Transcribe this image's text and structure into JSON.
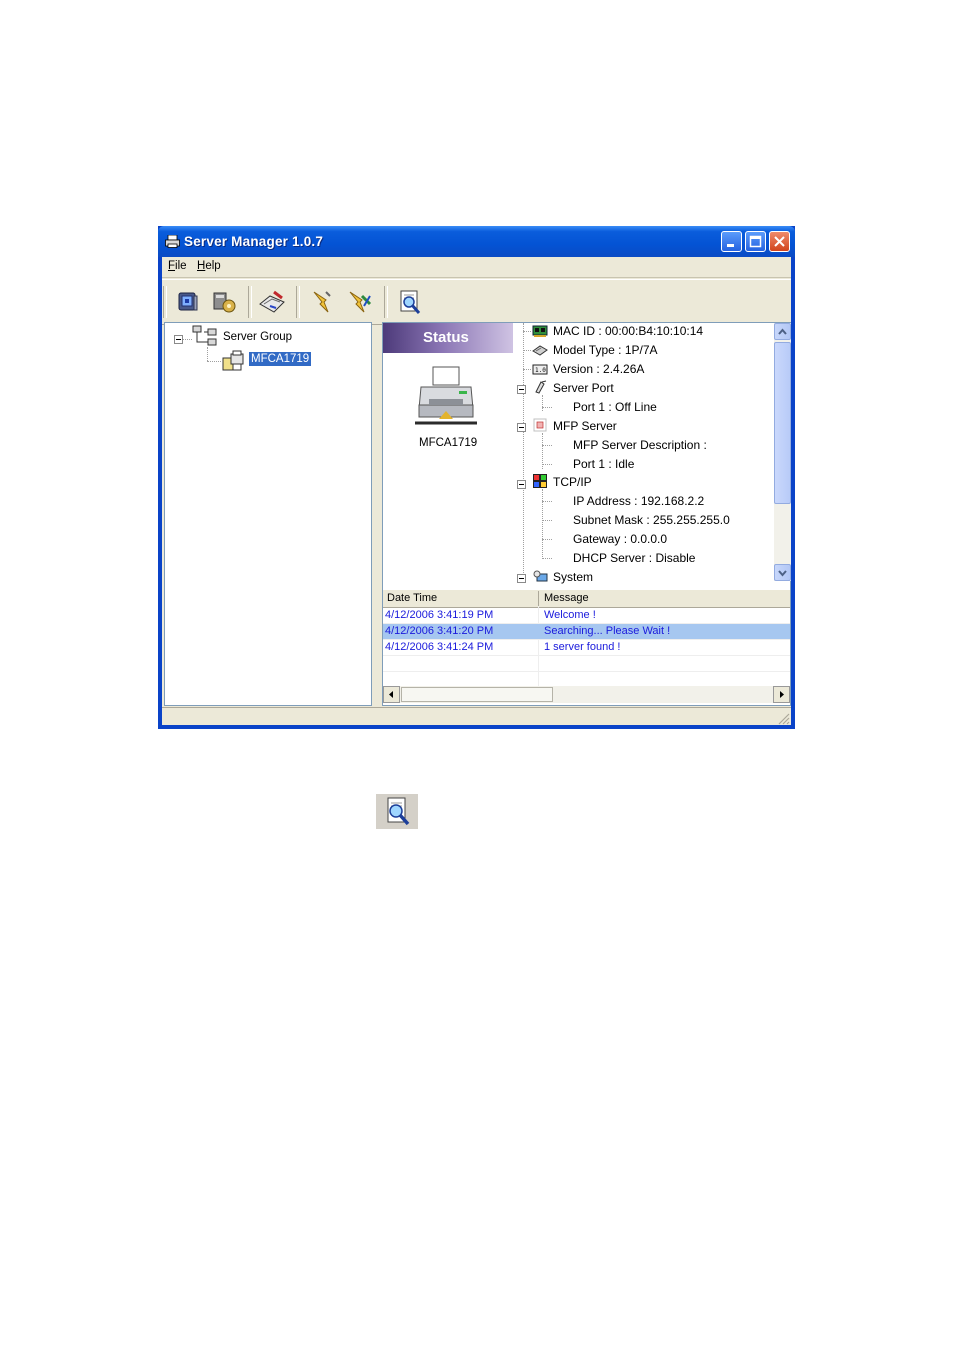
{
  "window": {
    "title": "Server Manager 1.0.7"
  },
  "menu": {
    "file": {
      "accel": "F",
      "rest": "ile"
    },
    "help": {
      "accel": "H",
      "rest": "elp"
    }
  },
  "toolbar": {
    "buttons": [
      {
        "icon": "server-settings-icon"
      },
      {
        "icon": "configure-icon"
      },
      {
        "icon": "edit-server-icon"
      },
      {
        "icon": "connect-icon"
      },
      {
        "icon": "disconnect-icon"
      },
      {
        "icon": "search-server-icon"
      }
    ]
  },
  "tree": {
    "root": "Server Group",
    "device": "MFCA1719"
  },
  "status": {
    "header": "Status",
    "device_name": "MFCA1719",
    "mac": "MAC ID : 00:00:B4:10:10:14",
    "model": "Model Type : 1P/7A",
    "version": "Version : 2.4.26A",
    "server_port": "Server Port",
    "port1_server": "Port 1 : Off Line",
    "mfp_server": "MFP Server",
    "mfp_desc": "MFP Server Description :",
    "port1_mfp": "Port 1 : Idle",
    "tcpip": "TCP/IP",
    "ip": "IP Address : 192.168.2.2",
    "subnet": "Subnet Mask : 255.255.255.0",
    "gateway": "Gateway : 0.0.0.0",
    "dhcp": "DHCP Server : Disable",
    "system": "System"
  },
  "log": {
    "columns": [
      "Date Time",
      "Message"
    ],
    "rows": [
      {
        "time": "4/12/2006 3:41:19 PM",
        "message": "Welcome !"
      },
      {
        "time": "4/12/2006 3:41:20 PM",
        "message": "Searching... Please Wait !"
      },
      {
        "time": "4/12/2006 3:41:24 PM",
        "message": "1 server found !"
      }
    ]
  },
  "colors": {
    "title_bar": "#0453d4",
    "selection": "#316ac5",
    "log_text": "#1a1adc"
  }
}
